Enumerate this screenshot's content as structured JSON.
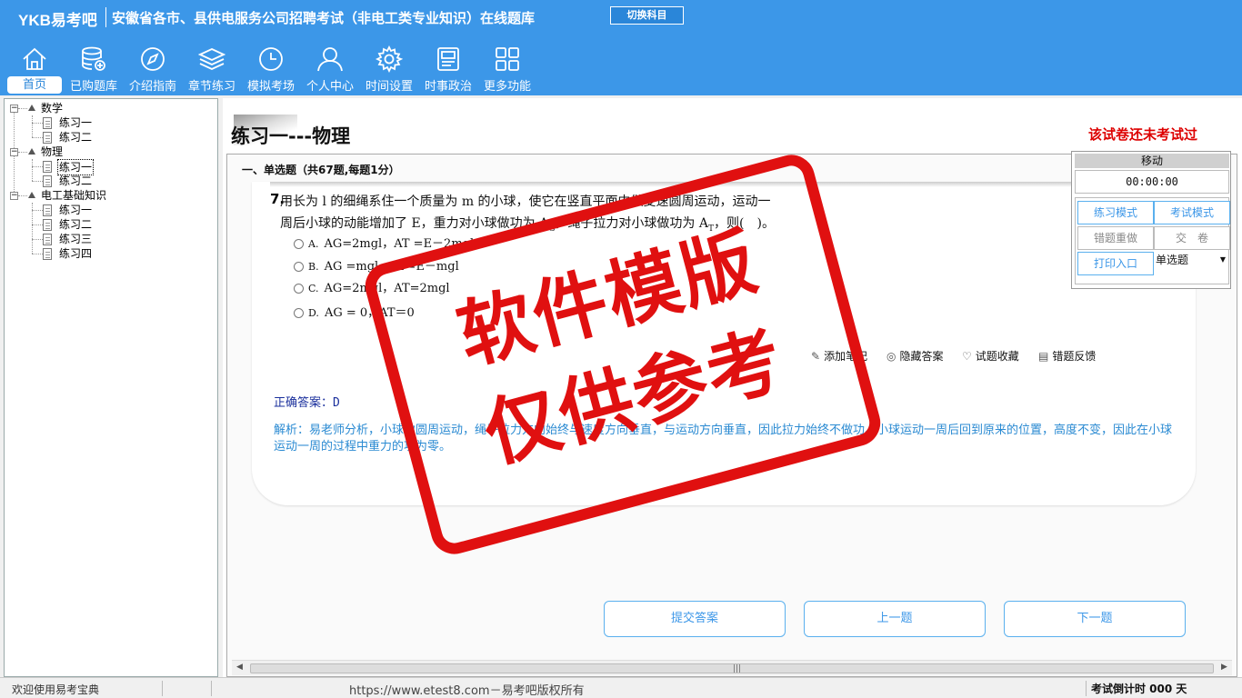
{
  "header": {
    "logo": "YKB易考吧",
    "title": "安徽省各市、县供电服务公司招聘考试（非电工类专业知识）在线题库",
    "switch_label": "切换科目"
  },
  "nav": {
    "items": [
      {
        "label": "首页",
        "icon": "home-icon"
      },
      {
        "label": "已购题库",
        "icon": "database-plus-icon"
      },
      {
        "label": "介绍指南",
        "icon": "compass-icon"
      },
      {
        "label": "章节练习",
        "icon": "layers-icon"
      },
      {
        "label": "模拟考场",
        "icon": "clock-icon"
      },
      {
        "label": "个人中心",
        "icon": "user-icon"
      },
      {
        "label": "时间设置",
        "icon": "gear-icon"
      },
      {
        "label": "时事政治",
        "icon": "news-icon"
      },
      {
        "label": "更多功能",
        "icon": "grid-icon"
      }
    ]
  },
  "tree": {
    "nodes": [
      {
        "label": "数学",
        "children": [
          "练习一",
          "练习二"
        ]
      },
      {
        "label": "物理",
        "children": [
          "练习一",
          "练习二"
        ]
      },
      {
        "label": "电工基础知识",
        "children": [
          "练习一",
          "练习二",
          "练习三",
          "练习四"
        ]
      }
    ]
  },
  "main": {
    "heading": "练习一---物理",
    "status": "该试卷还未考试过",
    "section": "一、单选题（共67题,每题1分）",
    "question": {
      "number": "7.",
      "text_line1": "用长为 l 的细绳系住一个质量为 m 的小球，使它在竖直平面内做变速圆周运动，运动一",
      "text_line2_a": "周后小球的动能增加了 E，重力对小球做功为 A",
      "text_line2_b": "，绳子拉力对小球做功为 A",
      "text_line2_c": "，则(　)。",
      "options": [
        {
          "letter": "A.",
          "text": "AG=2mgl，AT =E－2mgl"
        },
        {
          "letter": "B.",
          "text": "AG =mgl，AT=E－mgl"
        },
        {
          "letter": "C.",
          "text": "AG=2mgl，AT=2mgl"
        },
        {
          "letter": "D.",
          "text": "AG = 0，AT＝0"
        }
      ]
    },
    "actions": [
      "添加笔记",
      "隐藏答案",
      "试题收藏",
      "错题反馈"
    ],
    "answer": "正确答案：D",
    "analysis": "解析：易老师分析，小球做圆周运动，绳子拉力方向始终与速度方向垂直，与运动方向垂直，因此拉力始终不做功。小球运动一周后回到原来的位置，高度不变，因此在小球运动一周的过程中重力的功为零。",
    "buttons": {
      "submit": "提交答案",
      "prev": "上一题",
      "next": "下一题"
    }
  },
  "panel": {
    "title": "移动",
    "timer": "00:00:00",
    "practice_mode": "练习模式",
    "exam_mode": "考试模式",
    "redo_wrong": "错题重做",
    "hand_in": "交　卷",
    "print": "打印入口",
    "question_type": "单选题"
  },
  "stamp": {
    "line1": "软件模版",
    "line2": "仅供参考"
  },
  "statusbar": {
    "welcome": "欢迎使用易考宝典",
    "url": "https://www.etest8.com－易考吧版权所有",
    "countdown": "考试倒计时 000 天"
  }
}
